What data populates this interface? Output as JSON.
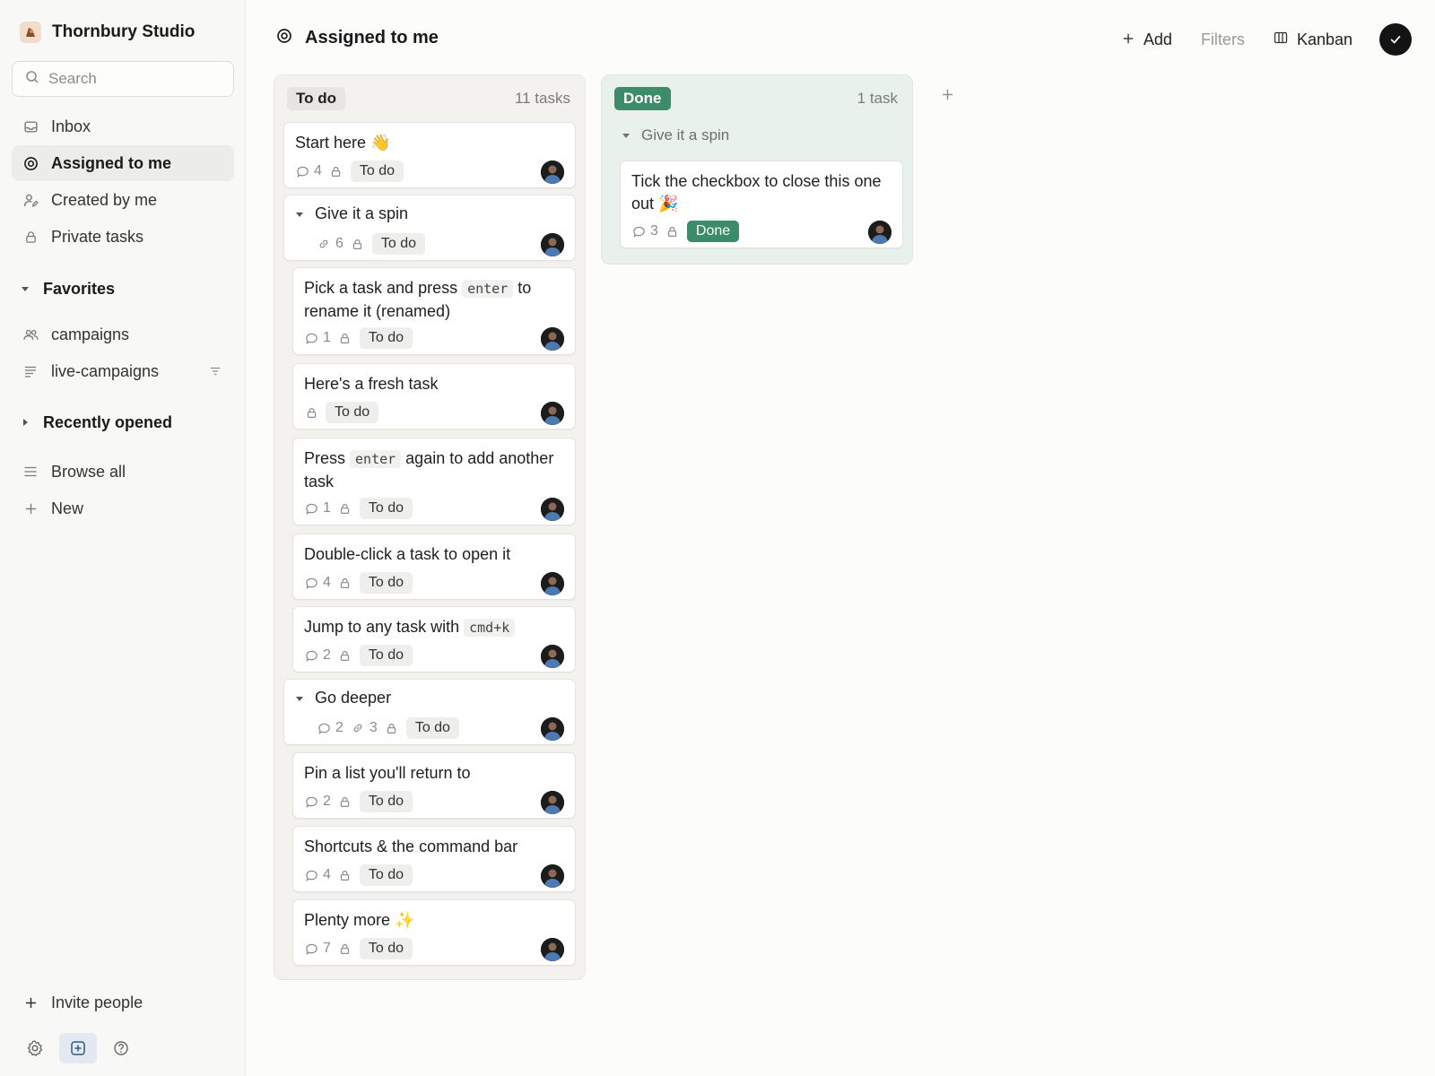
{
  "workspace": {
    "name": "Thornbury Studio"
  },
  "search": {
    "placeholder": "Search"
  },
  "nav": {
    "inbox": "Inbox",
    "assigned": "Assigned to me",
    "created": "Created by me",
    "private": "Private tasks"
  },
  "favorites": {
    "title": "Favorites",
    "items": [
      "campaigns",
      "live-campaigns"
    ]
  },
  "recent": {
    "title": "Recently opened"
  },
  "browse": {
    "label": "Browse all"
  },
  "new_item": {
    "label": "New"
  },
  "invite": {
    "label": "Invite people"
  },
  "header": {
    "title": "Assigned to me",
    "add": "Add",
    "filters": "Filters",
    "view": "Kanban"
  },
  "todo_column": {
    "label": "To do",
    "count": "11 tasks",
    "cards": [
      {
        "title": "Start here 👋",
        "comments": "4",
        "status": "To do"
      },
      {
        "title": "Give it a spin",
        "links": "6",
        "status": "To do"
      },
      {
        "title_a": "Pick a task and press ",
        "kbd": "enter",
        "title_b": " to rename it (renamed)",
        "comments": "1",
        "status": "To do"
      },
      {
        "title": "Here's a fresh task",
        "status": "To do"
      },
      {
        "title_a": "Press ",
        "kbd": "enter",
        "title_b": " again to add another task",
        "comments": "1",
        "status": "To do"
      },
      {
        "title": "Double-click a task to open it",
        "comments": "4",
        "status": "To do"
      },
      {
        "title_a": "Jump to any task with ",
        "kbd": "cmd+k",
        "comments": "2",
        "status": "To do"
      },
      {
        "title": "Go deeper",
        "comments": "2",
        "links": "3",
        "status": "To do"
      },
      {
        "title": "Pin a list you'll return to",
        "comments": "2",
        "status": "To do"
      },
      {
        "title": "Shortcuts & the command bar",
        "comments": "4",
        "status": "To do"
      },
      {
        "title": "Plenty more ✨",
        "comments": "7",
        "status": "To do"
      }
    ]
  },
  "done_column": {
    "label": "Done",
    "count": "1 task",
    "group": "Give it a spin",
    "cards": [
      {
        "title": "Tick the checkbox to close this one out 🎉",
        "comments": "3",
        "status": "Done"
      }
    ]
  },
  "colors": {
    "accent_done": "#3c8b69",
    "sidebar_bg": "#f8f8f6",
    "active_nav": "#ececea"
  }
}
